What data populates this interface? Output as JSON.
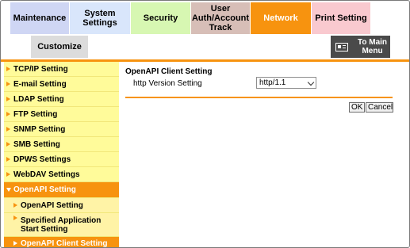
{
  "tabs": {
    "maintenance": "Maintenance",
    "system_settings": "System Settings",
    "security": "Security",
    "user_auth": "User Auth/Account Track",
    "network": "Network",
    "print_setting": "Print Setting",
    "customize": "Customize"
  },
  "main_menu": {
    "label": "To Main Menu",
    "icon": "main-menu-icon"
  },
  "sidebar": {
    "items": [
      {
        "label": "TCP/IP Setting"
      },
      {
        "label": "E-mail Setting"
      },
      {
        "label": "LDAP Setting"
      },
      {
        "label": "FTP Setting"
      },
      {
        "label": "SNMP Setting"
      },
      {
        "label": "SMB Setting"
      },
      {
        "label": "DPWS Settings"
      },
      {
        "label": "WebDAV Settings"
      },
      {
        "label": "OpenAPI Setting"
      }
    ],
    "subitems": [
      {
        "label": "OpenAPI Setting"
      },
      {
        "label": "Specified Application Start Setting"
      },
      {
        "label": "OpenAPI Client Setting"
      }
    ]
  },
  "content": {
    "title": "OpenAPI Client Setting",
    "http_label": "http Version Setting",
    "http_value": "http/1.1"
  },
  "buttons": {
    "ok": "OK",
    "cancel": "Cancel"
  },
  "colors": {
    "accent": "#f7930f",
    "sidebar": "#fffb9a"
  }
}
